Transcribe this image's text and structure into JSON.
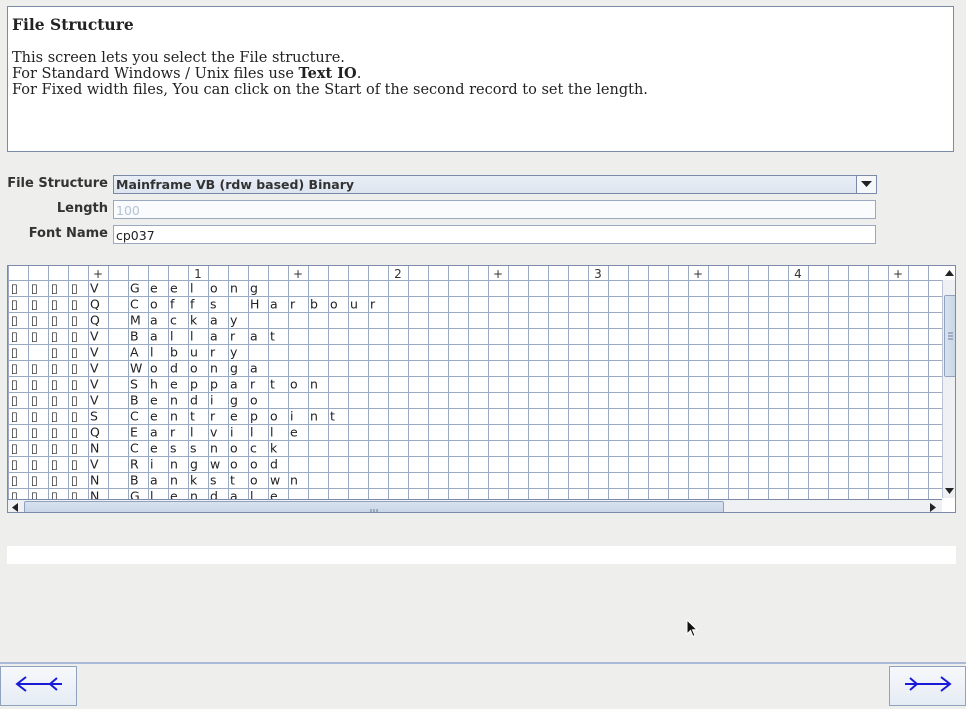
{
  "help": {
    "title": "File Structure",
    "line1": "This screen lets you select the File structure.",
    "line2_prefix": "For Standard Windows / Unix files use ",
    "line2_bold": "Text IO",
    "line2_suffix": ".",
    "line3": "For Fixed width files, You can click on the Start of the second record to set the length."
  },
  "form": {
    "file_structure_label": "File Structure",
    "file_structure_value": "Mainframe VB (rdw based) Binary",
    "length_label": "Length",
    "length_value": "100",
    "font_label": "Font Name",
    "font_value": "cp037"
  },
  "grid": {
    "ruler": [
      "",
      "",
      "",
      "",
      "+",
      "",
      "",
      "",
      "",
      "1",
      "",
      "",
      "",
      "",
      "+",
      "",
      "",
      "",
      "",
      "2",
      "",
      "",
      "",
      "",
      "+",
      "",
      "",
      "",
      "",
      "3",
      "",
      "",
      "",
      "",
      "+",
      "",
      "",
      "",
      "",
      "4",
      "",
      "",
      "",
      "",
      "+",
      "",
      ""
    ],
    "rows": [
      {
        "prefix": [
          "▯",
          "▯",
          "▯",
          "▯"
        ],
        "state": "V",
        "name": "Geelong"
      },
      {
        "prefix": [
          "▯",
          "▯",
          "▯",
          "▯"
        ],
        "state": "Q",
        "name": "Coffs Harbour"
      },
      {
        "prefix": [
          "▯",
          "▯",
          "▯",
          "▯"
        ],
        "state": "Q",
        "name": "Mackay"
      },
      {
        "prefix": [
          "▯",
          "▯",
          "▯",
          "▯"
        ],
        "state": "V",
        "name": "Ballarat"
      },
      {
        "prefix": [
          "▯",
          "",
          "▯",
          "▯"
        ],
        "state": "V",
        "name": "Albury"
      },
      {
        "prefix": [
          "▯",
          "▯",
          "▯",
          "▯"
        ],
        "state": "V",
        "name": "Wodonga"
      },
      {
        "prefix": [
          "▯",
          "▯",
          "▯",
          "▯"
        ],
        "state": "V",
        "name": "Shepparton"
      },
      {
        "prefix": [
          "▯",
          "▯",
          "▯",
          "▯"
        ],
        "state": "V",
        "name": "Bendigo"
      },
      {
        "prefix": [
          "▯",
          "▯",
          "▯",
          "▯"
        ],
        "state": "S",
        "name": "Centrepoint"
      },
      {
        "prefix": [
          "▯",
          "▯",
          "▯",
          "▯"
        ],
        "state": "Q",
        "name": "Earlville"
      },
      {
        "prefix": [
          "▯",
          "▯",
          "▯",
          "▯"
        ],
        "state": "N",
        "name": "Cessnock"
      },
      {
        "prefix": [
          "▯",
          "▯",
          "▯",
          "▯"
        ],
        "state": "V",
        "name": "Ringwood"
      },
      {
        "prefix": [
          "▯",
          "▯",
          "▯",
          "▯"
        ],
        "state": "N",
        "name": "Bankstown"
      },
      {
        "prefix": [
          "▯",
          "▯",
          "▯",
          "▯"
        ],
        "state": "N",
        "name": "Glendale"
      }
    ]
  },
  "status_text": "",
  "nav": {
    "back_icon": "left-arrow-icon",
    "next_icon": "right-arrow-icon"
  },
  "colors": {
    "grid_line": "#9aaac4",
    "border": "#7a8aa8",
    "arrow": "#1a1ad6"
  }
}
